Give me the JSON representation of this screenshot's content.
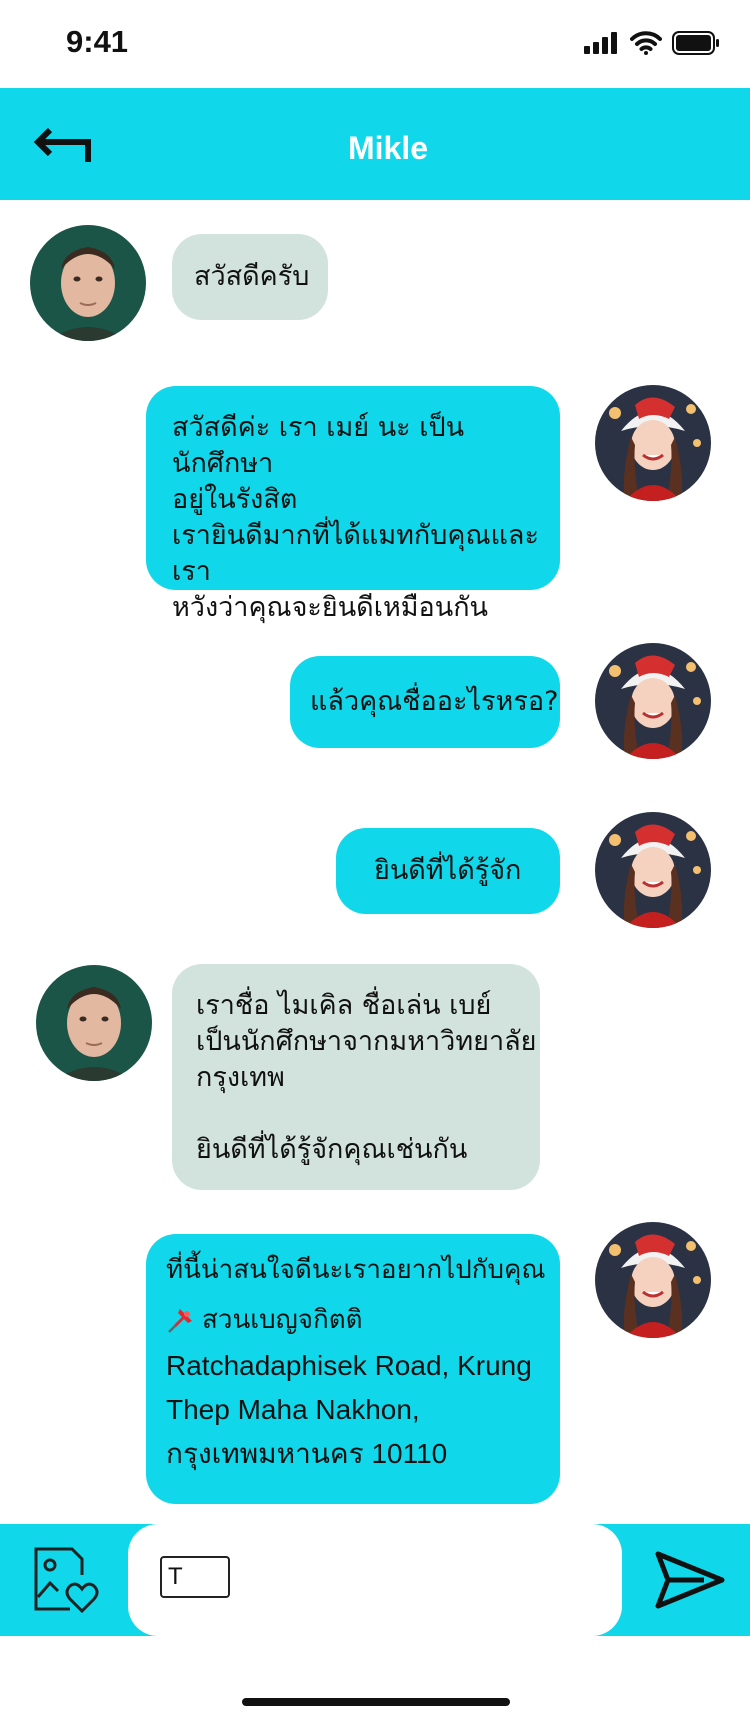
{
  "status_bar": {
    "time": "9:41"
  },
  "header": {
    "title": "Mikle"
  },
  "messages": [
    {
      "from": "mikle",
      "lines": [
        "สวัสดีครับ"
      ]
    },
    {
      "from": "me",
      "lines": [
        "สวัสดีค่ะ เรา เมย์ นะ เป็นนักศึกษา",
        "อยู่ในรังสิต",
        "เรายินดีมากที่ได้แมทกับคุณและเรา",
        "หวังว่าคุณจะยินดีเหมือนกัน"
      ]
    },
    {
      "from": "me",
      "lines": [
        "แล้วคุณชื่ออะไรหรอ?"
      ]
    },
    {
      "from": "me",
      "lines": [
        "ยินดีที่ได้รู้จัก"
      ]
    },
    {
      "from": "mikle",
      "lines": [
        "เราชื่อ ไมเคิล ชื่อเล่น เบย์",
        "เป็นนักศึกษาจากมหาวิทยาลัย",
        "กรุงเทพ",
        "ยินดีที่ได้รู้จักคุณเช่นกัน"
      ]
    },
    {
      "from": "me",
      "lines": [
        "ที่นี้น่าสนใจดีนะเราอยากไปกับคุณ"
      ],
      "location": {
        "name": "สวนเบญจกิตติ",
        "address_lines": [
          "Ratchadaphisek Road, Krung",
          "Thep Maha Nakhon,",
          "กรุงเทพมหานคร 10110"
        ]
      }
    }
  ],
  "composer": {
    "input_value": "T"
  },
  "icons": {
    "back": "back-arrow-icon",
    "gallery": "image-heart-icon",
    "send": "send-icon",
    "pin": "pushpin-icon"
  },
  "colors": {
    "accent": "#10d8ea",
    "incoming_bubble": "#d2e3de",
    "title_text": "#ffffff"
  }
}
